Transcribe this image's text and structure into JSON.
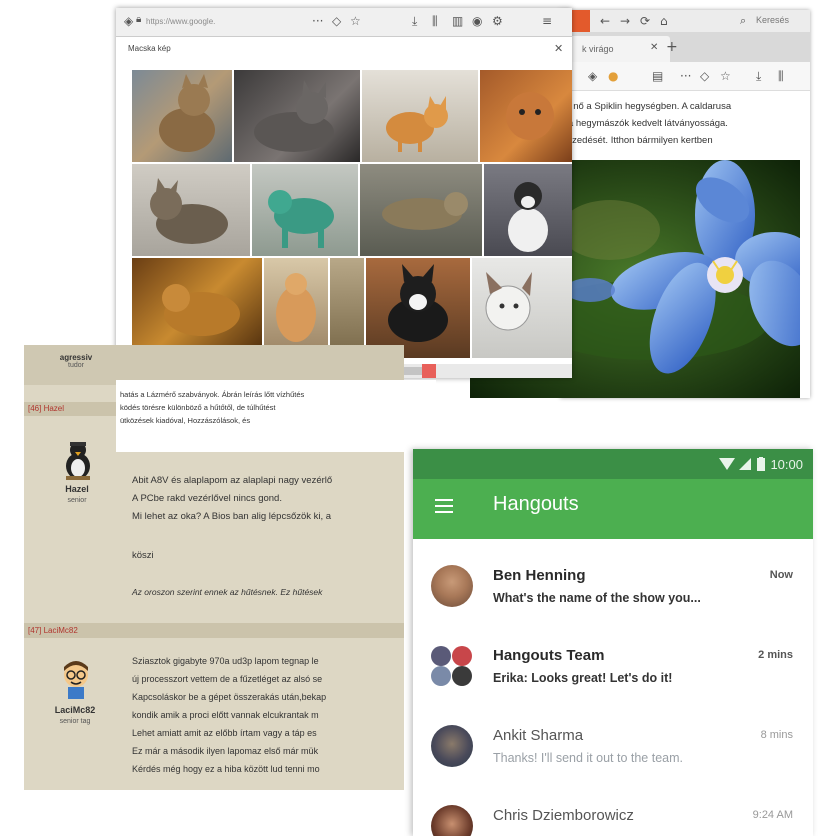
{
  "back_browser": {
    "tab_title": "k virágo",
    "search_label": "Keresés",
    "article_lines": [
      "en nő a Spiklin hegységben. A caldarusa",
      "n a hegymászók kedvelt látványossága.",
      "leszedését. Itthon bármilyen kertben"
    ]
  },
  "front_browser": {
    "url": "https://www.google.",
    "page_title": "Macska kép"
  },
  "forum": {
    "user1_name": "agressiv",
    "user1_rank": "tudor",
    "fragment_lines": [
      "hatás a Lázmérő szabványok. Ábrán leírás lőtt vízhűtés",
      "ködés törésre különböző a hűtőtől, de túlhűtést",
      "ütközések kiadóval, Hozzászólások, és"
    ],
    "post46": {
      "header": "[46] Hazel",
      "username": "Hazel",
      "rank": "senior",
      "lines": [
        "Abit A8V és alaplapom az alaplapi nagy vezérlő",
        "A PCbe rakd vezérlővel nincs gond.",
        "Mi lehet az oka? A Bios ban alig lépcsőzök ki, a",
        "köszi",
        "Az oroszon szerint ennek az hűtésnek. Ez hűtések"
      ]
    },
    "post47": {
      "header": "[47] LaciMc82",
      "username": "LaciMc82",
      "rank": "senior tag",
      "lines": [
        "Sziasztok gigabyte 970a ud3p lapom tegnap le",
        "új processzort vettem de a fűzetléget az alsó se",
        "Kapcsoláskor be a gépet összerakás után,bekap",
        "kondik amik a proci előtt vannak elcukrantak m",
        "Lehet amiatt amit az előbb írtam vagy a táp es",
        "Ez már a második ilyen lapomaz első már mük",
        "Kérdés még hogy ez a hiba között lud tenni mo"
      ]
    }
  },
  "hangouts": {
    "status_time": "10:00",
    "app_title": "Hangouts",
    "conversations": [
      {
        "name": "Ben Henning",
        "message": "What's the name of the show you...",
        "time": "Now"
      },
      {
        "name": "Hangouts Team",
        "message": "Erika: Looks great! Let's do it!",
        "time": "2 mins"
      },
      {
        "name": "Ankit Sharma",
        "message": "Thanks! I'll send it out to the team.",
        "time": "8 mins"
      },
      {
        "name": "Chris Dziemborowicz",
        "message": "",
        "time": "9:24 AM"
      }
    ]
  },
  "colors": {
    "hangouts_green": "#4caf50",
    "status_green": "#3b8f46",
    "forum_bg": "#ddd7c4",
    "forum_header_red": "#b0352e"
  }
}
